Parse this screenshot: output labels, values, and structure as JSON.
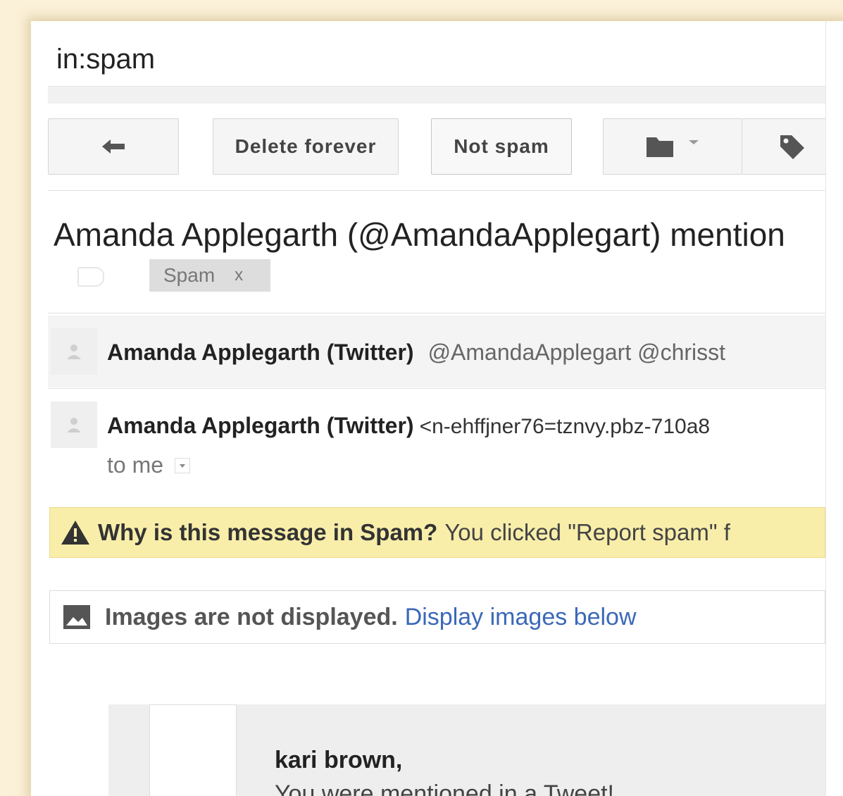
{
  "search": {
    "query": "in:spam"
  },
  "toolbar": {
    "back_icon": "back-arrow-icon",
    "delete_forever": "Delete forever",
    "not_spam": "Not spam",
    "move_icon": "folder-icon",
    "labels_icon": "tag-icon"
  },
  "thread": {
    "subject": "Amanda Applegarth (@AmandaApplegart) mention",
    "label": "Spam",
    "label_remove": "x"
  },
  "messages": [
    {
      "sender": "Amanda Applegarth (Twitter)",
      "snippet": "@AmandaApplegart @chrisst"
    },
    {
      "sender": "Amanda Applegarth (Twitter)",
      "address": "<n-ehffjner76=tznvy.pbz-710a8",
      "to": "to me"
    }
  ],
  "spam_warning": {
    "question": "Why is this message in Spam?",
    "explanation": "You clicked \"Report spam\" f"
  },
  "images_notice": {
    "message": "Images are not displayed.",
    "link": "Display images below"
  },
  "email_body": {
    "greeting": "kari brown,",
    "next_line": "You were mentioned in a Tweet!"
  },
  "colors": {
    "background": "#fbf1d8",
    "warning": "#f8eeaa",
    "link": "#3b68b8"
  }
}
